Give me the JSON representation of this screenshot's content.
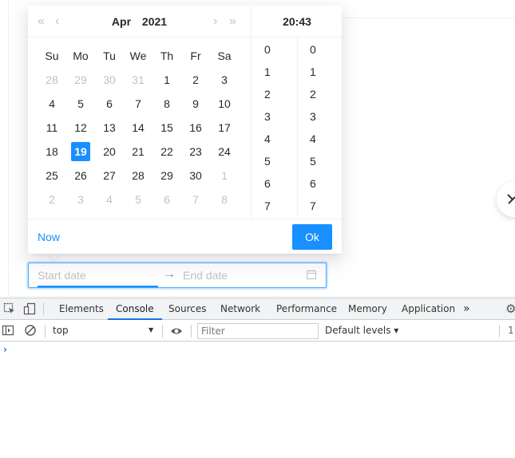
{
  "picker": {
    "header": {
      "super_prev_icon": "double-left-icon",
      "prev_icon": "left-icon",
      "month": "Apr",
      "year": "2021",
      "next_icon": "right-icon",
      "super_next_icon": "double-right-icon"
    },
    "weekdays": [
      "Su",
      "Mo",
      "Tu",
      "We",
      "Th",
      "Fr",
      "Sa"
    ],
    "weeks": [
      [
        {
          "d": "28",
          "out": true
        },
        {
          "d": "29",
          "out": true
        },
        {
          "d": "30",
          "out": true
        },
        {
          "d": "31",
          "out": true
        },
        {
          "d": "1"
        },
        {
          "d": "2"
        },
        {
          "d": "3"
        }
      ],
      [
        {
          "d": "4"
        },
        {
          "d": "5"
        },
        {
          "d": "6"
        },
        {
          "d": "7"
        },
        {
          "d": "8"
        },
        {
          "d": "9"
        },
        {
          "d": "10"
        }
      ],
      [
        {
          "d": "11"
        },
        {
          "d": "12"
        },
        {
          "d": "13"
        },
        {
          "d": "14"
        },
        {
          "d": "15"
        },
        {
          "d": "16"
        },
        {
          "d": "17"
        }
      ],
      [
        {
          "d": "18"
        },
        {
          "d": "19",
          "selected": true
        },
        {
          "d": "20"
        },
        {
          "d": "21"
        },
        {
          "d": "22"
        },
        {
          "d": "23"
        },
        {
          "d": "24"
        }
      ],
      [
        {
          "d": "25"
        },
        {
          "d": "26"
        },
        {
          "d": "27"
        },
        {
          "d": "28"
        },
        {
          "d": "29"
        },
        {
          "d": "30"
        },
        {
          "d": "1",
          "out": true
        }
      ],
      [
        {
          "d": "2",
          "out": true
        },
        {
          "d": "3",
          "out": true
        },
        {
          "d": "4",
          "out": true
        },
        {
          "d": "5",
          "out": true
        },
        {
          "d": "6",
          "out": true
        },
        {
          "d": "7",
          "out": true
        },
        {
          "d": "8",
          "out": true
        }
      ]
    ],
    "time_header": "20:43",
    "hours": [
      "0",
      "1",
      "2",
      "3",
      "4",
      "5",
      "6",
      "7"
    ],
    "minutes": [
      "0",
      "1",
      "2",
      "3",
      "4",
      "5",
      "6",
      "7"
    ],
    "now_label": "Now",
    "ok_label": "Ok"
  },
  "range": {
    "start_placeholder": "Start date",
    "separator": "→",
    "end_placeholder": "End date",
    "calendar_icon": "calendar-icon"
  },
  "devtools": {
    "tabs": [
      "Elements",
      "Console",
      "Sources",
      "Network",
      "Performance",
      "Memory",
      "Application"
    ],
    "active_tab": "Console",
    "more_label": "»",
    "context": "top",
    "filter_placeholder": "Filter",
    "levels_label": "Default levels ▾",
    "issue_count": "1",
    "prompt_symbol": "›"
  },
  "colors": {
    "primary": "#1890ff",
    "devtools_active": "#1a73e8"
  }
}
